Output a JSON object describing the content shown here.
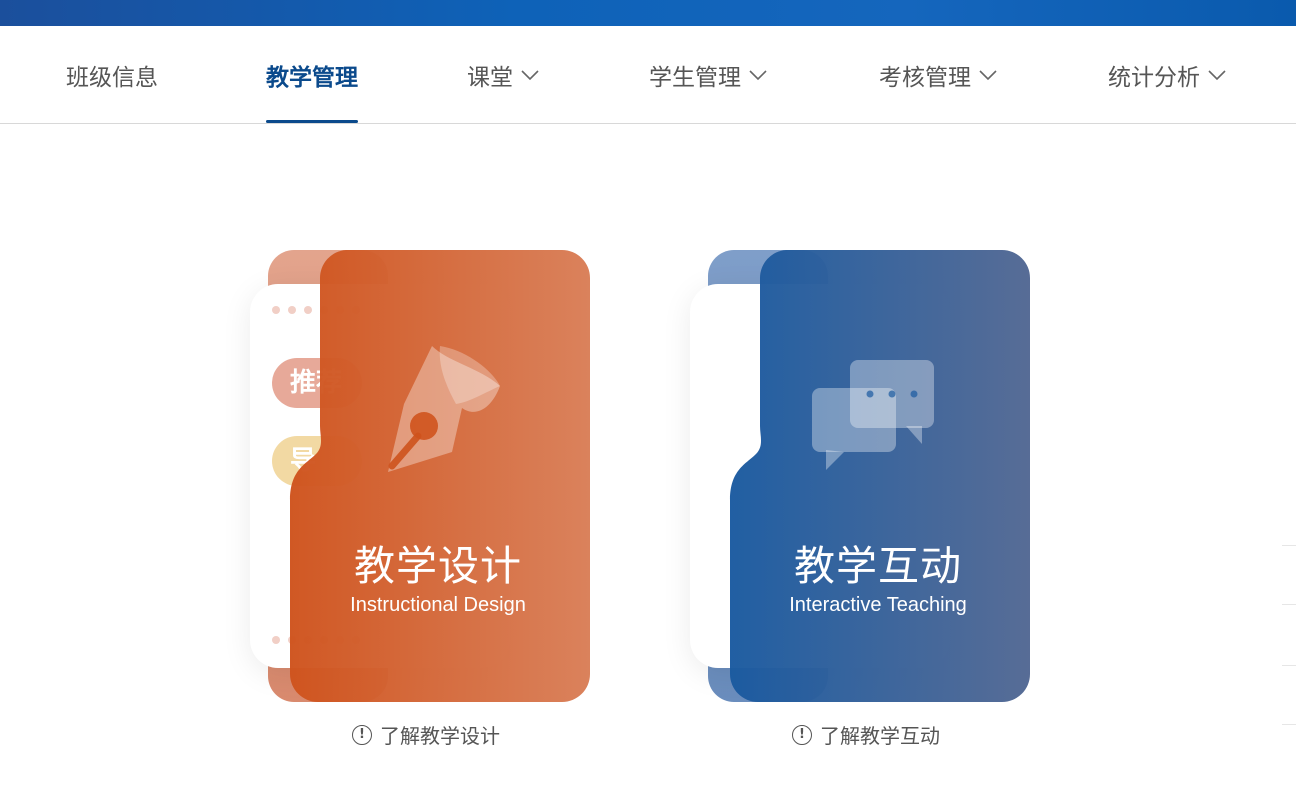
{
  "nav": {
    "items": [
      {
        "label": "班级信息",
        "active": false,
        "dropdown": false
      },
      {
        "label": "教学管理",
        "active": true,
        "dropdown": false
      },
      {
        "label": "课堂",
        "active": false,
        "dropdown": true
      },
      {
        "label": "学生管理",
        "active": false,
        "dropdown": true
      },
      {
        "label": "考核管理",
        "active": false,
        "dropdown": true
      },
      {
        "label": "统计分析",
        "active": false,
        "dropdown": true
      }
    ]
  },
  "cards": [
    {
      "title": "教学设计",
      "subtitle": "Instructional Design",
      "icon": "pen-nib-icon",
      "peek_labels": [
        "推荐",
        "导"
      ],
      "learn_more": "了解教学设计",
      "color": "#d45a28"
    },
    {
      "title": "教学互动",
      "subtitle": "Interactive Teaching",
      "icon": "chat-bubbles-icon",
      "learn_more": "了解教学互动",
      "color": "#1e5a9e"
    }
  ],
  "colors": {
    "accent": "#0b4a8c",
    "header_band": "#0e62b8"
  }
}
